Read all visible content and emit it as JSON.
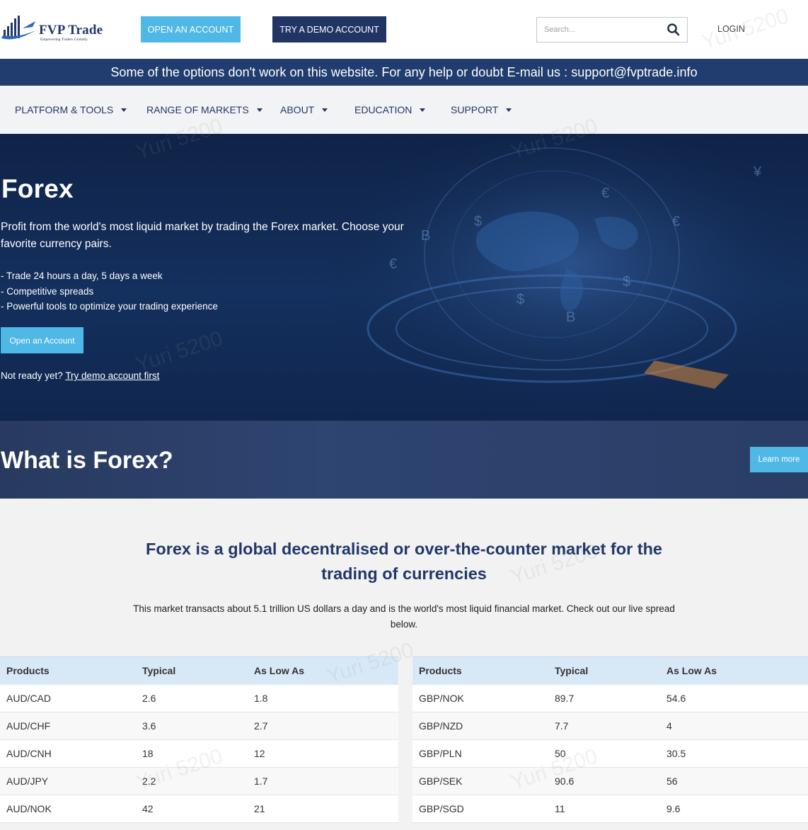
{
  "header": {
    "logo_name": "FVP Trade",
    "logo_tagline": "Empowering Traders Globally",
    "open_account_label": "OPEN AN ACCOUNT",
    "demo_account_label": "TRY A DEMO ACCOUNT",
    "search_placeholder": "Search...",
    "login_label": "LOGIN"
  },
  "notice": {
    "text": "Some of the options don't work on this website. For any help or doubt E-mail us : support@fvptrade.info"
  },
  "nav": {
    "items": [
      {
        "label": "PLATFORM & TOOLS"
      },
      {
        "label": "RANGE OF MARKETS"
      },
      {
        "label": "ABOUT"
      },
      {
        "label": "EDUCATION"
      },
      {
        "label": "SUPPORT"
      }
    ]
  },
  "hero": {
    "title": "Forex",
    "intro": "Profit from the world's most liquid market by trading the Forex market. Choose your favorite currency pairs.",
    "bullets": [
      "- Trade 24 hours a day, 5 days a week",
      "- Competitive spreads",
      "- Powerful tools to optimize your trading experience"
    ],
    "button_label": "Open an Account",
    "not_ready_text": "Not ready yet?",
    "demo_link_text": "Try demo account first"
  },
  "band": {
    "title": "What is Forex?",
    "learn_more_label": "Learn more"
  },
  "section": {
    "title": "Forex is a global decentralised or over-the-counter market for the trading of currencies",
    "text": "This market transacts about 5.1 trillion US dollars a day and is the world's most liquid financial market. Check out our live spread below."
  },
  "spreads": {
    "headers": [
      "Products",
      "Typical",
      "As Low As"
    ],
    "left": [
      [
        "AUD/CAD",
        "2.6",
        "1.8"
      ],
      [
        "AUD/CHF",
        "3.6",
        "2.7"
      ],
      [
        "AUD/CNH",
        "18",
        "12"
      ],
      [
        "AUD/JPY",
        "2.2",
        "1.7"
      ],
      [
        "AUD/NOK",
        "42",
        "21"
      ]
    ],
    "right": [
      [
        "GBP/NOK",
        "89.7",
        "54.6"
      ],
      [
        "GBP/NZD",
        "7.7",
        "4"
      ],
      [
        "GBP/PLN",
        "50",
        "30.5"
      ],
      [
        "GBP/SEK",
        "90.6",
        "56"
      ],
      [
        "GBP/SGD",
        "11",
        "9.6"
      ]
    ]
  },
  "watermark": {
    "text": "Yuri 5200"
  },
  "colors": {
    "brand_navy": "#213564",
    "accent_blue": "#4fb8e6",
    "notice_bg": "#213d6f",
    "table_header_bg": "#d7e9f7"
  }
}
